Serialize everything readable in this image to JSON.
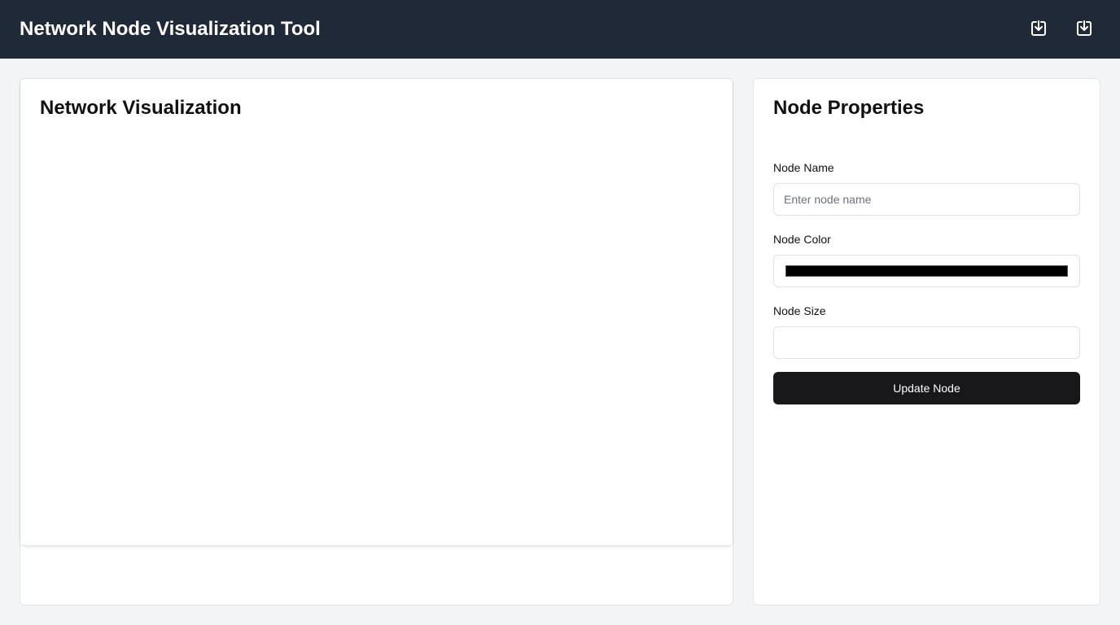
{
  "header": {
    "title": "Network Node Visualization Tool",
    "actions": [
      {
        "icon": "download-icon"
      },
      {
        "icon": "download-icon"
      }
    ]
  },
  "visualization": {
    "title": "Network Visualization"
  },
  "properties": {
    "title": "Node Properties",
    "name_label": "Node Name",
    "name_placeholder": "Enter node name",
    "name_value": "",
    "color_label": "Node Color",
    "color_value": "#000000",
    "size_label": "Node Size",
    "size_value": "",
    "update_label": "Update Node"
  },
  "colors": {
    "header_bg": "#1f2937",
    "page_bg": "#f2f4f6",
    "button_bg": "#18181b"
  }
}
